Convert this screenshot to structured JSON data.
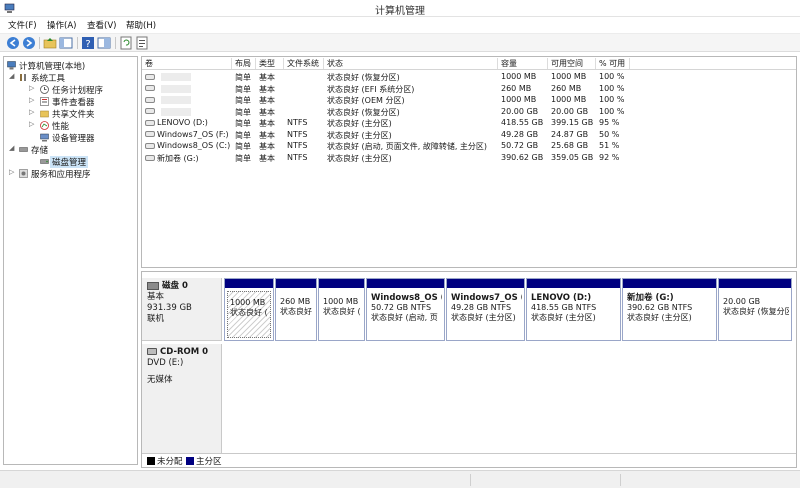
{
  "window": {
    "title": "计算机管理"
  },
  "menu": [
    "文件(F)",
    "操作(A)",
    "查看(V)",
    "帮助(H)"
  ],
  "toolbar": [
    "back-arrow-icon",
    "forward-arrow-icon",
    "folder-up-icon",
    "show-tree-icon",
    "help-icon",
    "properties-icon",
    "refresh-icon",
    "export-icon"
  ],
  "tree": {
    "root": "计算机管理(本地)",
    "system_tools": "系统工具",
    "task_scheduler": "任务计划程序",
    "event_viewer": "事件查看器",
    "shared_folders": "共享文件夹",
    "performance": "性能",
    "device_manager": "设备管理器",
    "storage": "存储",
    "disk_management": "磁盘管理",
    "services_apps": "服务和应用程序"
  },
  "volume_table": {
    "headers": [
      "卷",
      "布局",
      "类型",
      "文件系统",
      "状态",
      "容量",
      "可用空间",
      "% 可用"
    ],
    "rows": [
      [
        "",
        "简单",
        "基本",
        "",
        "状态良好 (恢复分区)",
        "1000 MB",
        "1000 MB",
        "100 %"
      ],
      [
        "",
        "简单",
        "基本",
        "",
        "状态良好 (EFI 系统分区)",
        "260 MB",
        "260 MB",
        "100 %"
      ],
      [
        "",
        "简单",
        "基本",
        "",
        "状态良好 (OEM 分区)",
        "1000 MB",
        "1000 MB",
        "100 %"
      ],
      [
        "",
        "简单",
        "基本",
        "",
        "状态良好 (恢复分区)",
        "20.00 GB",
        "20.00 GB",
        "100 %"
      ],
      [
        "LENOVO (D:)",
        "简单",
        "基本",
        "NTFS",
        "状态良好 (主分区)",
        "418.55 GB",
        "399.15 GB",
        "95 %"
      ],
      [
        "Windows7_OS (F:)",
        "简单",
        "基本",
        "NTFS",
        "状态良好 (主分区)",
        "49.28 GB",
        "24.87 GB",
        "50 %"
      ],
      [
        "Windows8_OS (C:)",
        "简单",
        "基本",
        "NTFS",
        "状态良好 (启动, 页面文件, 故障转储, 主分区)",
        "50.72 GB",
        "25.68 GB",
        "51 %"
      ],
      [
        "新加卷 (G:)",
        "简单",
        "基本",
        "NTFS",
        "状态良好 (主分区)",
        "390.62 GB",
        "359.05 GB",
        "92 %"
      ]
    ]
  },
  "disk0": {
    "name": "磁盘 0",
    "type": "基本",
    "size": "931.39 GB",
    "status": "联机",
    "partitions": [
      {
        "name": "",
        "size": "1000 MB",
        "status": "状态良好 ("
      },
      {
        "name": "",
        "size": "260 MB",
        "status": "状态良好 ("
      },
      {
        "name": "",
        "size": "1000 MB",
        "status": "状态良好 ("
      },
      {
        "name": "Windows8_OS (",
        "size": "50.72 GB NTFS",
        "status": "状态良好 (启动, 页"
      },
      {
        "name": "Windows7_OS (",
        "size": "49.28 GB NTFS",
        "status": "状态良好 (主分区)"
      },
      {
        "name": "LENOVO (D:)",
        "size": "418.55 GB NTFS",
        "status": "状态良好 (主分区)"
      },
      {
        "name": "新加卷 (G:)",
        "size": "390.62 GB NTFS",
        "status": "状态良好 (主分区)"
      },
      {
        "name": "",
        "size": "20.00 GB",
        "status": "状态良好 (恢复分区"
      }
    ]
  },
  "cdrom0": {
    "name": "CD-ROM 0",
    "type": "DVD (E:)",
    "status": "无媒体"
  },
  "legend": {
    "unallocated": "未分配",
    "primary": "主分区",
    "unallocated_color": "#000000",
    "primary_color": "#000080"
  },
  "colors": {
    "partition_bar": "#000080",
    "selection": "#cce4f7"
  }
}
